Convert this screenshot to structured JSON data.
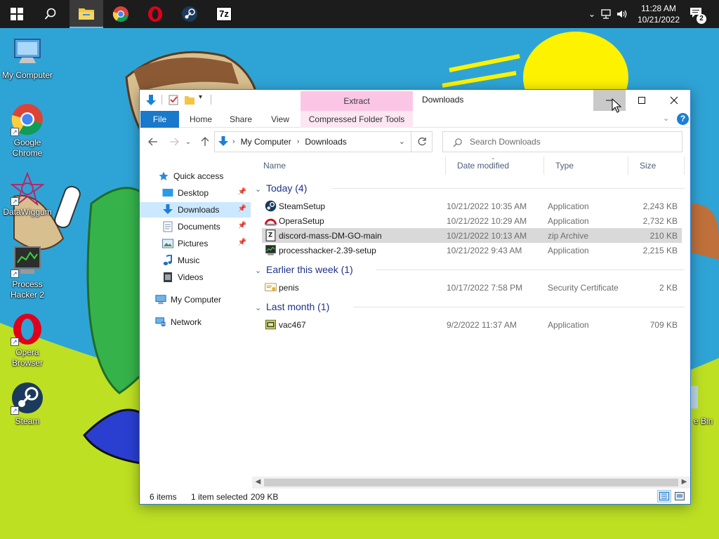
{
  "taskbar": {
    "apps": [
      {
        "name": "File Explorer",
        "active": true
      },
      {
        "name": "Google Chrome",
        "active": false
      },
      {
        "name": "Opera",
        "active": false
      },
      {
        "name": "Steam",
        "active": false
      },
      {
        "name": "7-Zip",
        "active": false
      }
    ],
    "sevenzip_label": "7z",
    "clock_time": "11:28 AM",
    "clock_date": "10/21/2022",
    "notification_count": "2"
  },
  "desktop": {
    "icons": [
      {
        "label": "My Computer"
      },
      {
        "label": "Google Chrome"
      },
      {
        "label": "DataWiggum"
      },
      {
        "label": "Process Hacker 2"
      },
      {
        "label": "Opera Browser"
      },
      {
        "label": "Steam"
      }
    ],
    "recycle_bin_label": "e Bin"
  },
  "explorer": {
    "title": "Downloads",
    "contextual_group": "Extract",
    "ribbon_tabs": {
      "file": "File",
      "home": "Home",
      "share": "Share",
      "view": "View",
      "compressed": "Compressed Folder Tools"
    },
    "address": {
      "crumb1": "My Computer",
      "crumb2": "Downloads"
    },
    "search": {
      "placeholder": "Search Downloads"
    },
    "nav": {
      "quick_access": "Quick access",
      "desktop": "Desktop",
      "downloads": "Downloads",
      "documents": "Documents",
      "pictures": "Pictures",
      "music": "Music",
      "videos": "Videos",
      "my_computer": "My Computer",
      "network": "Network"
    },
    "columns": {
      "name": "Name",
      "date": "Date modified",
      "type": "Type",
      "size": "Size"
    },
    "groups": [
      {
        "label": "Today (4)",
        "files": [
          {
            "name": "SteamSetup",
            "date": "10/21/2022 10:35 AM",
            "type": "Application",
            "size": "2,243 KB",
            "icon": "steam-icon",
            "selected": false
          },
          {
            "name": "OperaSetup",
            "date": "10/21/2022 10:29 AM",
            "type": "Application",
            "size": "2,732 KB",
            "icon": "opera-setup-icon",
            "selected": false
          },
          {
            "name": "discord-mass-DM-GO-main",
            "date": "10/21/2022 10:13 AM",
            "type": "zip Archive",
            "size": "210 KB",
            "icon": "zip-archive-icon",
            "selected": true
          },
          {
            "name": "processhacker-2.39-setup",
            "date": "10/21/2022 9:43 AM",
            "type": "Application",
            "size": "2,215 KB",
            "icon": "process-hacker-icon",
            "selected": false
          }
        ]
      },
      {
        "label": "Earlier this week (1)",
        "files": [
          {
            "name": "penis",
            "date": "10/17/2022 7:58 PM",
            "type": "Security Certificate",
            "size": "2 KB",
            "icon": "certificate-icon",
            "selected": false
          }
        ]
      },
      {
        "label": "Last month (1)",
        "files": [
          {
            "name": "vac467",
            "date": "9/2/2022 11:37 AM",
            "type": "Application",
            "size": "709 KB",
            "icon": "application-icon",
            "selected": false
          }
        ]
      }
    ],
    "status": {
      "item_count": "6 items",
      "selection": "1 item selected",
      "selection_size": "209 KB"
    }
  },
  "colors": {
    "accent": "#1979ca",
    "context_tab": "#fbc6e5",
    "selection": "#cce8ff",
    "group_header": "#1e3287"
  }
}
